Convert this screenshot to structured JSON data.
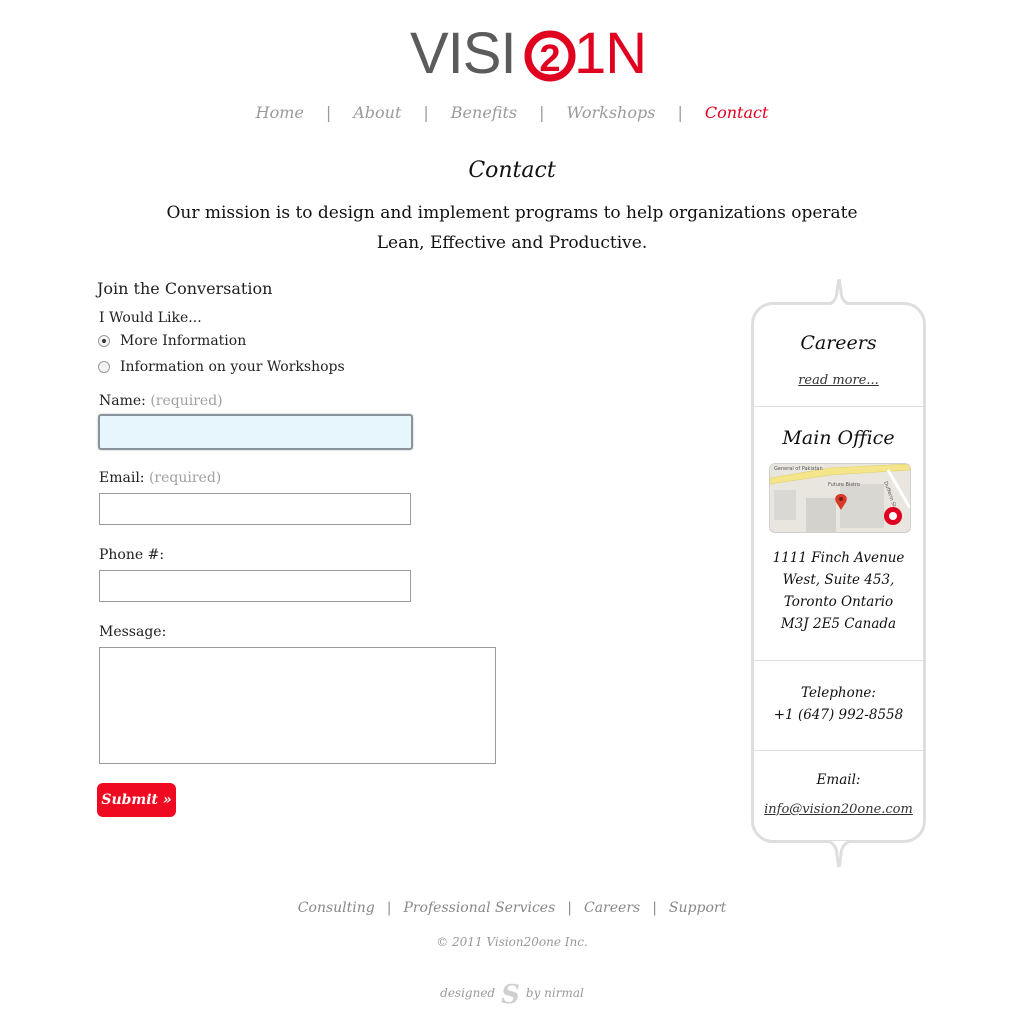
{
  "logo": {
    "part1": "VISI",
    "part2": "2",
    "part3": "1N"
  },
  "nav": {
    "items": [
      "Home",
      "About",
      "Benefits",
      "Workshops",
      "Contact"
    ],
    "active": "Contact",
    "separator": "|"
  },
  "page": {
    "title": "Contact",
    "mission_line1": "Our mission is to design and implement programs to help organizations operate",
    "mission_line2": "Lean, Effective and Productive."
  },
  "form": {
    "heading": "Join the Conversation",
    "would_like": "I Would Like...",
    "radio_options": [
      {
        "label": "More Information",
        "checked": true
      },
      {
        "label": "Information on your Workshops",
        "checked": false
      }
    ],
    "name_label": "Name:",
    "email_label": "Email:",
    "phone_label": "Phone #:",
    "message_label": "Message:",
    "required_hint": "(required)",
    "name_value": "",
    "email_value": "",
    "phone_value": "",
    "message_value": "",
    "submit_label": "Submit »"
  },
  "sidebar": {
    "careers_heading": "Careers",
    "careers_link": "read more...",
    "office_heading": "Main Office",
    "address": [
      "1111 Finch Avenue",
      "West, Suite 453,",
      "Toronto Ontario",
      "M3J 2E5 Canada"
    ],
    "telephone_label": "Telephone:",
    "telephone_value": "+1 (647) 992-8558",
    "email_label": "Email:",
    "email_value": "info@vision20one.com",
    "map_labels": [
      "General of Pakistan",
      "Future Bistro",
      "Dufferin St"
    ]
  },
  "footer": {
    "links": [
      "Consulting",
      "Professional Services",
      "Careers",
      "Support"
    ],
    "copyright": "© 2011 Vision20one Inc.",
    "designed_left": "designed",
    "designed_right": "by nirmal"
  },
  "colors": {
    "accent": "#e0001f",
    "nav_grey": "#9a9a9a",
    "border": "#dedede"
  }
}
